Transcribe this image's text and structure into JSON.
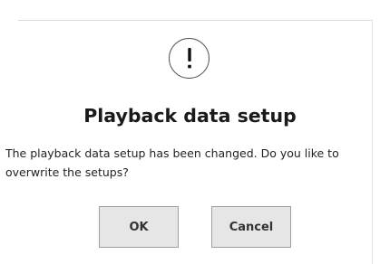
{
  "dialog": {
    "icon": "exclamation-circle-icon",
    "title": "Playback data setup",
    "message_line1": "The playback data setup has been changed. Do you like to",
    "message_line2": "overwrite the setups?",
    "ok_label": "OK",
    "cancel_label": "Cancel"
  }
}
